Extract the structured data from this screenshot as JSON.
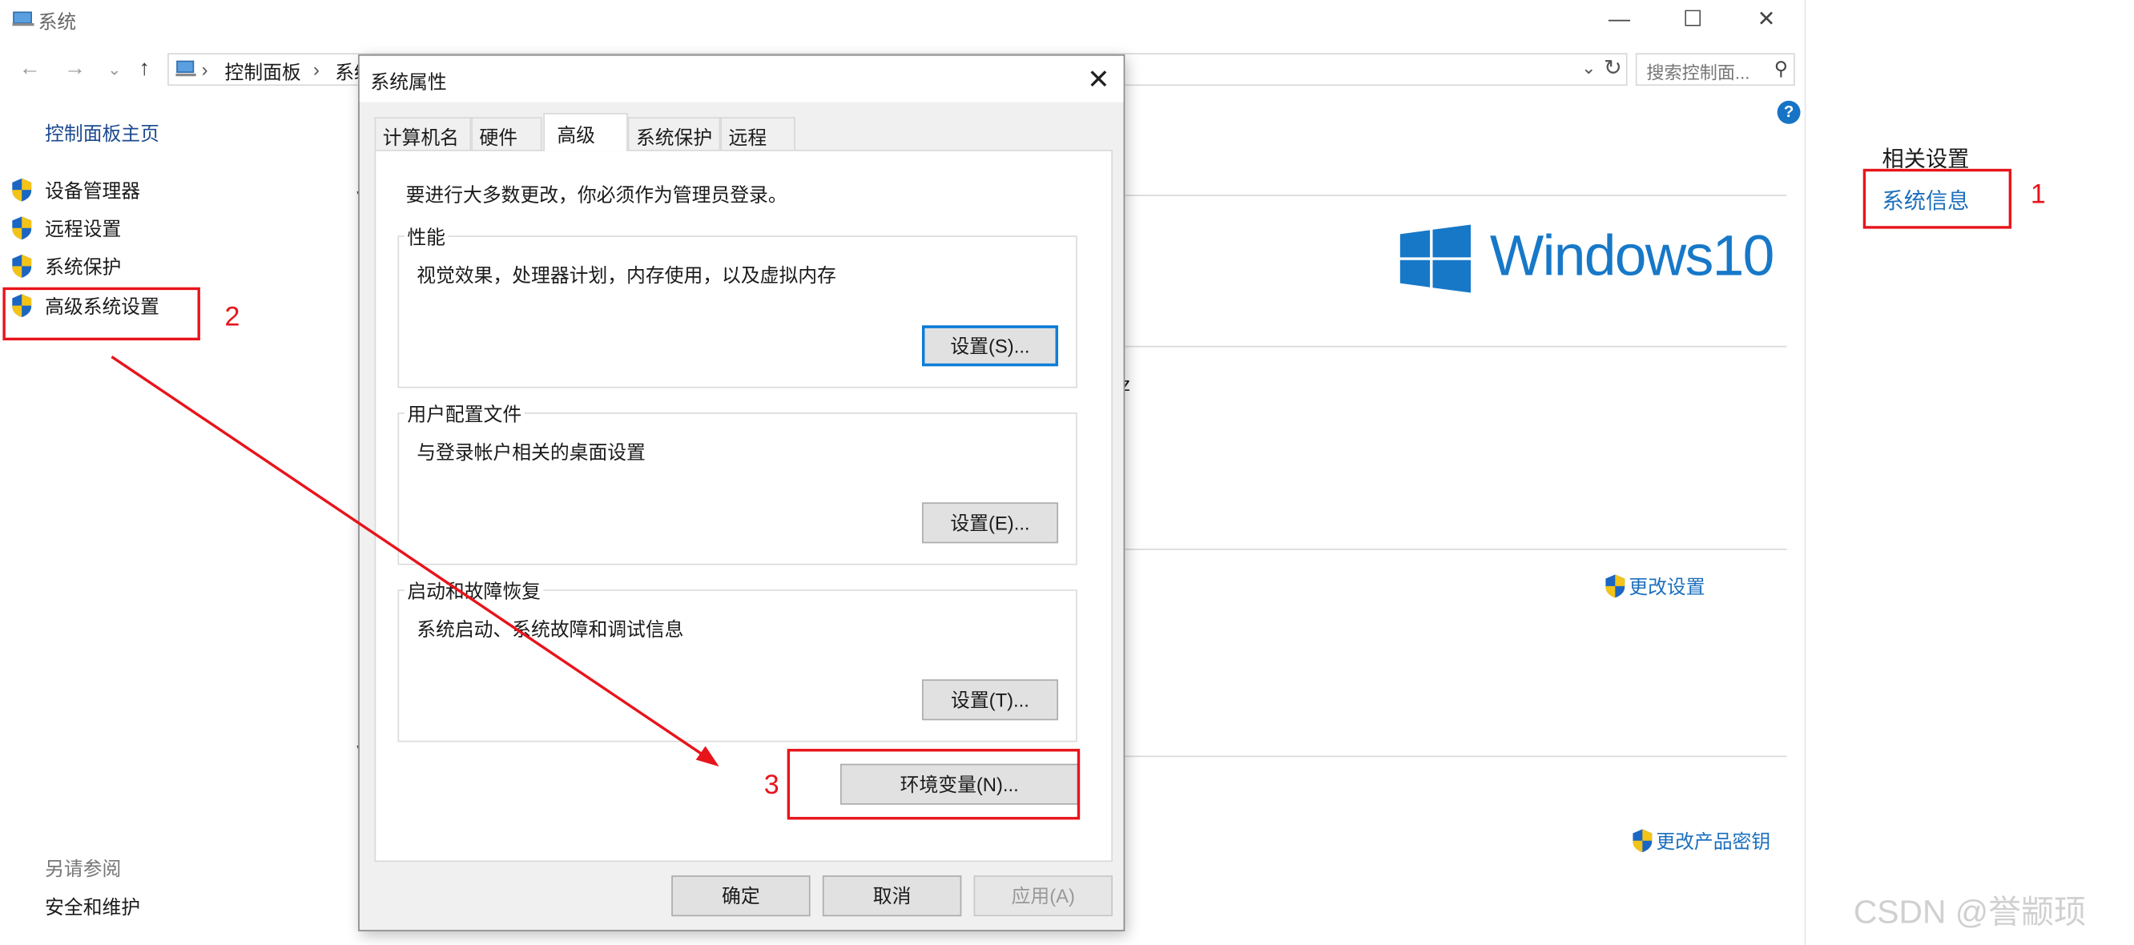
{
  "window": {
    "title": "系统",
    "controls": {
      "minimize": "—",
      "maximize": "☐",
      "close": "✕"
    }
  },
  "addressbar": {
    "crumb1": "控制面板",
    "crumb2": "系统",
    "sep": "›",
    "search_placeholder": "搜索控制面...",
    "back": "←",
    "forward": "→",
    "recent": "⌄",
    "up": "↑"
  },
  "left_nav": {
    "home": "控制面板主页",
    "items": [
      {
        "label": "设备管理器"
      },
      {
        "label": "远程设置"
      },
      {
        "label": "系统保护"
      },
      {
        "label": "高级系统设置"
      }
    ],
    "see_also": "另请参阅",
    "security": "安全和维护"
  },
  "right_panel": {
    "related_title": "相关设置",
    "system_info": "系统信息"
  },
  "background": {
    "brand": "Windows10",
    "change_settings": "更改设置",
    "change_product_key": "更改产品密钥",
    "fragment_z": "z"
  },
  "dialog": {
    "title": "系统属性",
    "close": "✕",
    "tabs": [
      "计算机名",
      "硬件",
      "高级",
      "系统保护",
      "远程"
    ],
    "active_tab": "高级",
    "admin_note": "要进行大多数更改，你必须作为管理员登录。",
    "performance": {
      "title": "性能",
      "desc": "视觉效果，处理器计划，内存使用，以及虚拟内存",
      "button": "设置(S)..."
    },
    "user_profiles": {
      "title": "用户配置文件",
      "desc": "与登录帐户相关的桌面设置",
      "button": "设置(E)..."
    },
    "startup_recovery": {
      "title": "启动和故障恢复",
      "desc": "系统启动、系统故障和调试信息",
      "button": "设置(T)..."
    },
    "env_button": "环境变量(N)...",
    "ok": "确定",
    "cancel": "取消",
    "apply": "应用(A)"
  },
  "annotations": {
    "step1": "1",
    "step2": "2",
    "step3": "3",
    "color": "#e8141b"
  },
  "watermark": "CSDN @誉颛顼"
}
